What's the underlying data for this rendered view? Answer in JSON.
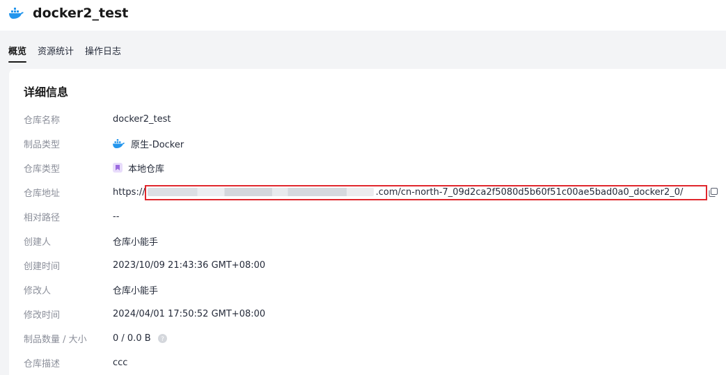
{
  "header": {
    "repo_name": "docker2_test",
    "icon": "docker-whale-icon"
  },
  "tabs": [
    {
      "label": "概览",
      "active": true
    },
    {
      "label": "资源统计",
      "active": false
    },
    {
      "label": "操作日志",
      "active": false
    }
  ],
  "details": {
    "title": "详细信息",
    "fields": {
      "repo_name": {
        "label": "仓库名称",
        "value": "docker2_test"
      },
      "artifact_type": {
        "label": "制品类型",
        "value": "原生-Docker",
        "icon": "docker-whale-icon"
      },
      "repo_type": {
        "label": "仓库类型",
        "value": "本地仓库",
        "icon": "local-repo-icon"
      },
      "repo_address": {
        "label": "仓库地址",
        "prefix": "https://",
        "suffix": ".com/cn-north-7_09d2ca2f5080d5b60f51c00ae5bad0a0_docker2_0/",
        "copy_icon": "copy-icon"
      },
      "relative_path": {
        "label": "相对路径",
        "value": "--"
      },
      "creator": {
        "label": "创建人",
        "value": "仓库小能手"
      },
      "created_time": {
        "label": "创建时间",
        "value": "2023/10/09 21:43:36 GMT+08:00"
      },
      "modifier": {
        "label": "修改人",
        "value": "仓库小能手"
      },
      "modified_time": {
        "label": "修改时间",
        "value": "2024/04/01 17:50:52 GMT+08:00"
      },
      "artifact_count_size": {
        "label": "制品数量 / 大小",
        "value": "0 / 0.0 B",
        "icon": "help-icon"
      },
      "description": {
        "label": "仓库描述",
        "value": "ccc"
      }
    }
  },
  "colors": {
    "accent": "#191919",
    "highlight_border": "#e0262c",
    "docker_blue": "#2496ed",
    "local_repo_purple": "#9b6bdf",
    "label_gray": "#8a8e99"
  }
}
